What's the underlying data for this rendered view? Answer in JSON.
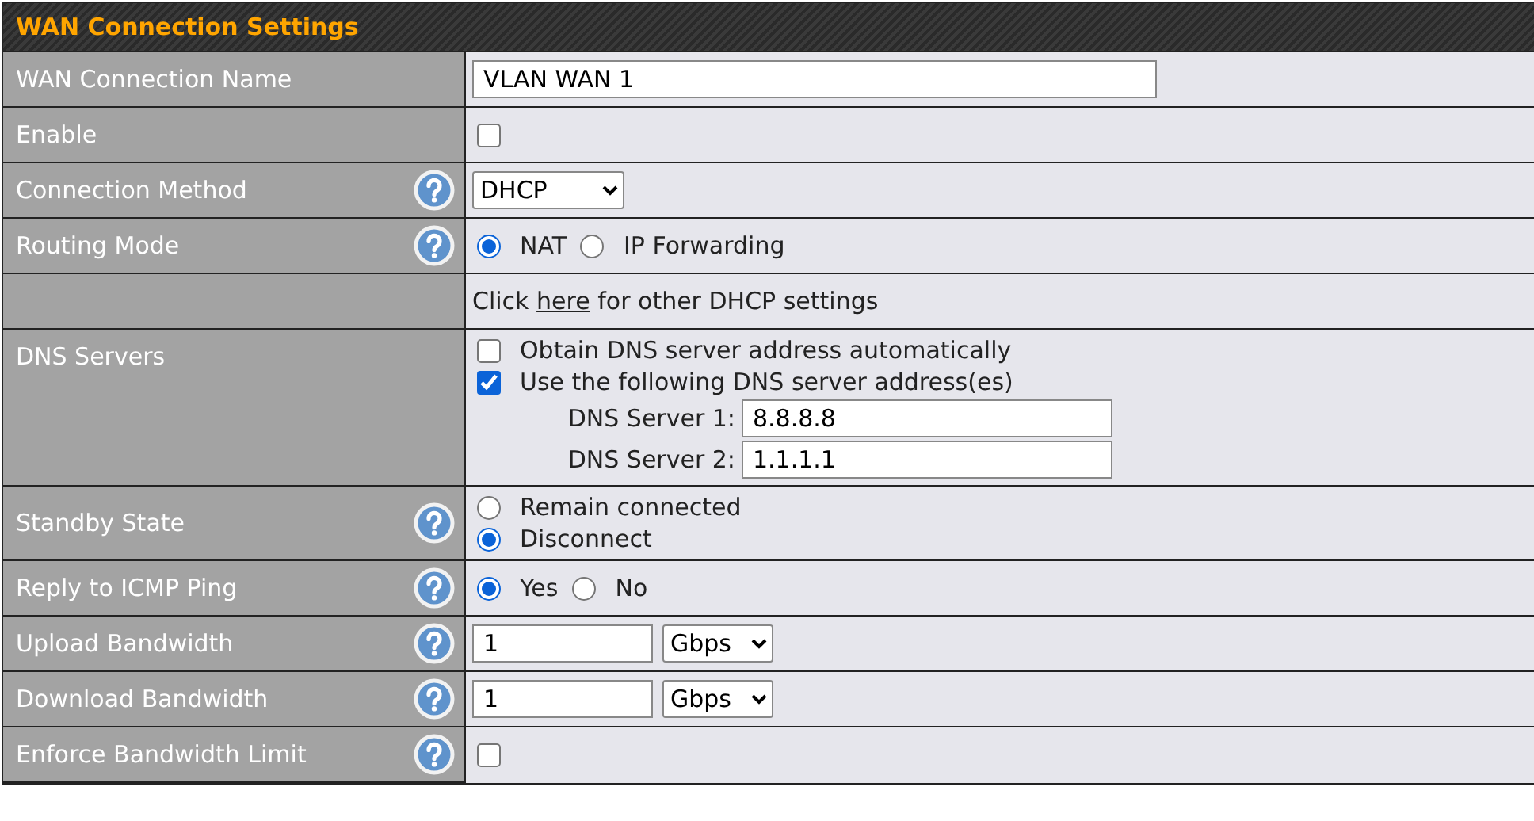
{
  "title": "WAN Connection Settings",
  "rows": [
    {
      "label": "WAN Connection Name",
      "help": false,
      "kind": "text",
      "value": "VLAN WAN 1"
    },
    {
      "label": "Enable",
      "help": false,
      "kind": "checkbox",
      "checked": false
    },
    {
      "label": "Connection Method",
      "help": true,
      "kind": "select",
      "value": "DHCP"
    },
    {
      "label": "Routing Mode",
      "help": true,
      "kind": "radio",
      "options": [
        {
          "label": "NAT",
          "selected": true
        },
        {
          "label": "IP Forwarding",
          "selected": false
        }
      ]
    },
    {
      "help": false,
      "kind": "note",
      "before": "Click",
      "link": "here",
      "after": "for other DHCP settings"
    },
    {
      "label": "DNS Servers",
      "help": false,
      "kind": "dns",
      "options": [
        {
          "label": "Obtain DNS server address automatically",
          "checked": false
        },
        {
          "label": "Use the following DNS server address(es)",
          "checked": true
        }
      ],
      "servers": [
        {
          "label": "DNS Server 1:",
          "value": "8.8.8.8"
        },
        {
          "label": "DNS Server 2:",
          "value": "1.1.1.1"
        }
      ]
    },
    {
      "label": "Standby State",
      "help": true,
      "kind": "radio_stack",
      "options": [
        {
          "label": "Remain connected",
          "selected": false
        },
        {
          "label": "Disconnect",
          "selected": true
        }
      ]
    },
    {
      "label": "Reply to ICMP Ping",
      "help": true,
      "kind": "radio",
      "options": [
        {
          "label": "Yes",
          "selected": true
        },
        {
          "label": "No",
          "selected": false
        }
      ]
    },
    {
      "label": "Upload Bandwidth",
      "help": true,
      "kind": "bandwidth",
      "value": "1",
      "unit": "Gbps"
    },
    {
      "label": "Download Bandwidth",
      "help": true,
      "kind": "bandwidth",
      "value": "1",
      "unit": "Gbps"
    },
    {
      "label": "Enforce Bandwidth Limit",
      "help": true,
      "kind": "checkbox",
      "checked": false
    }
  ]
}
